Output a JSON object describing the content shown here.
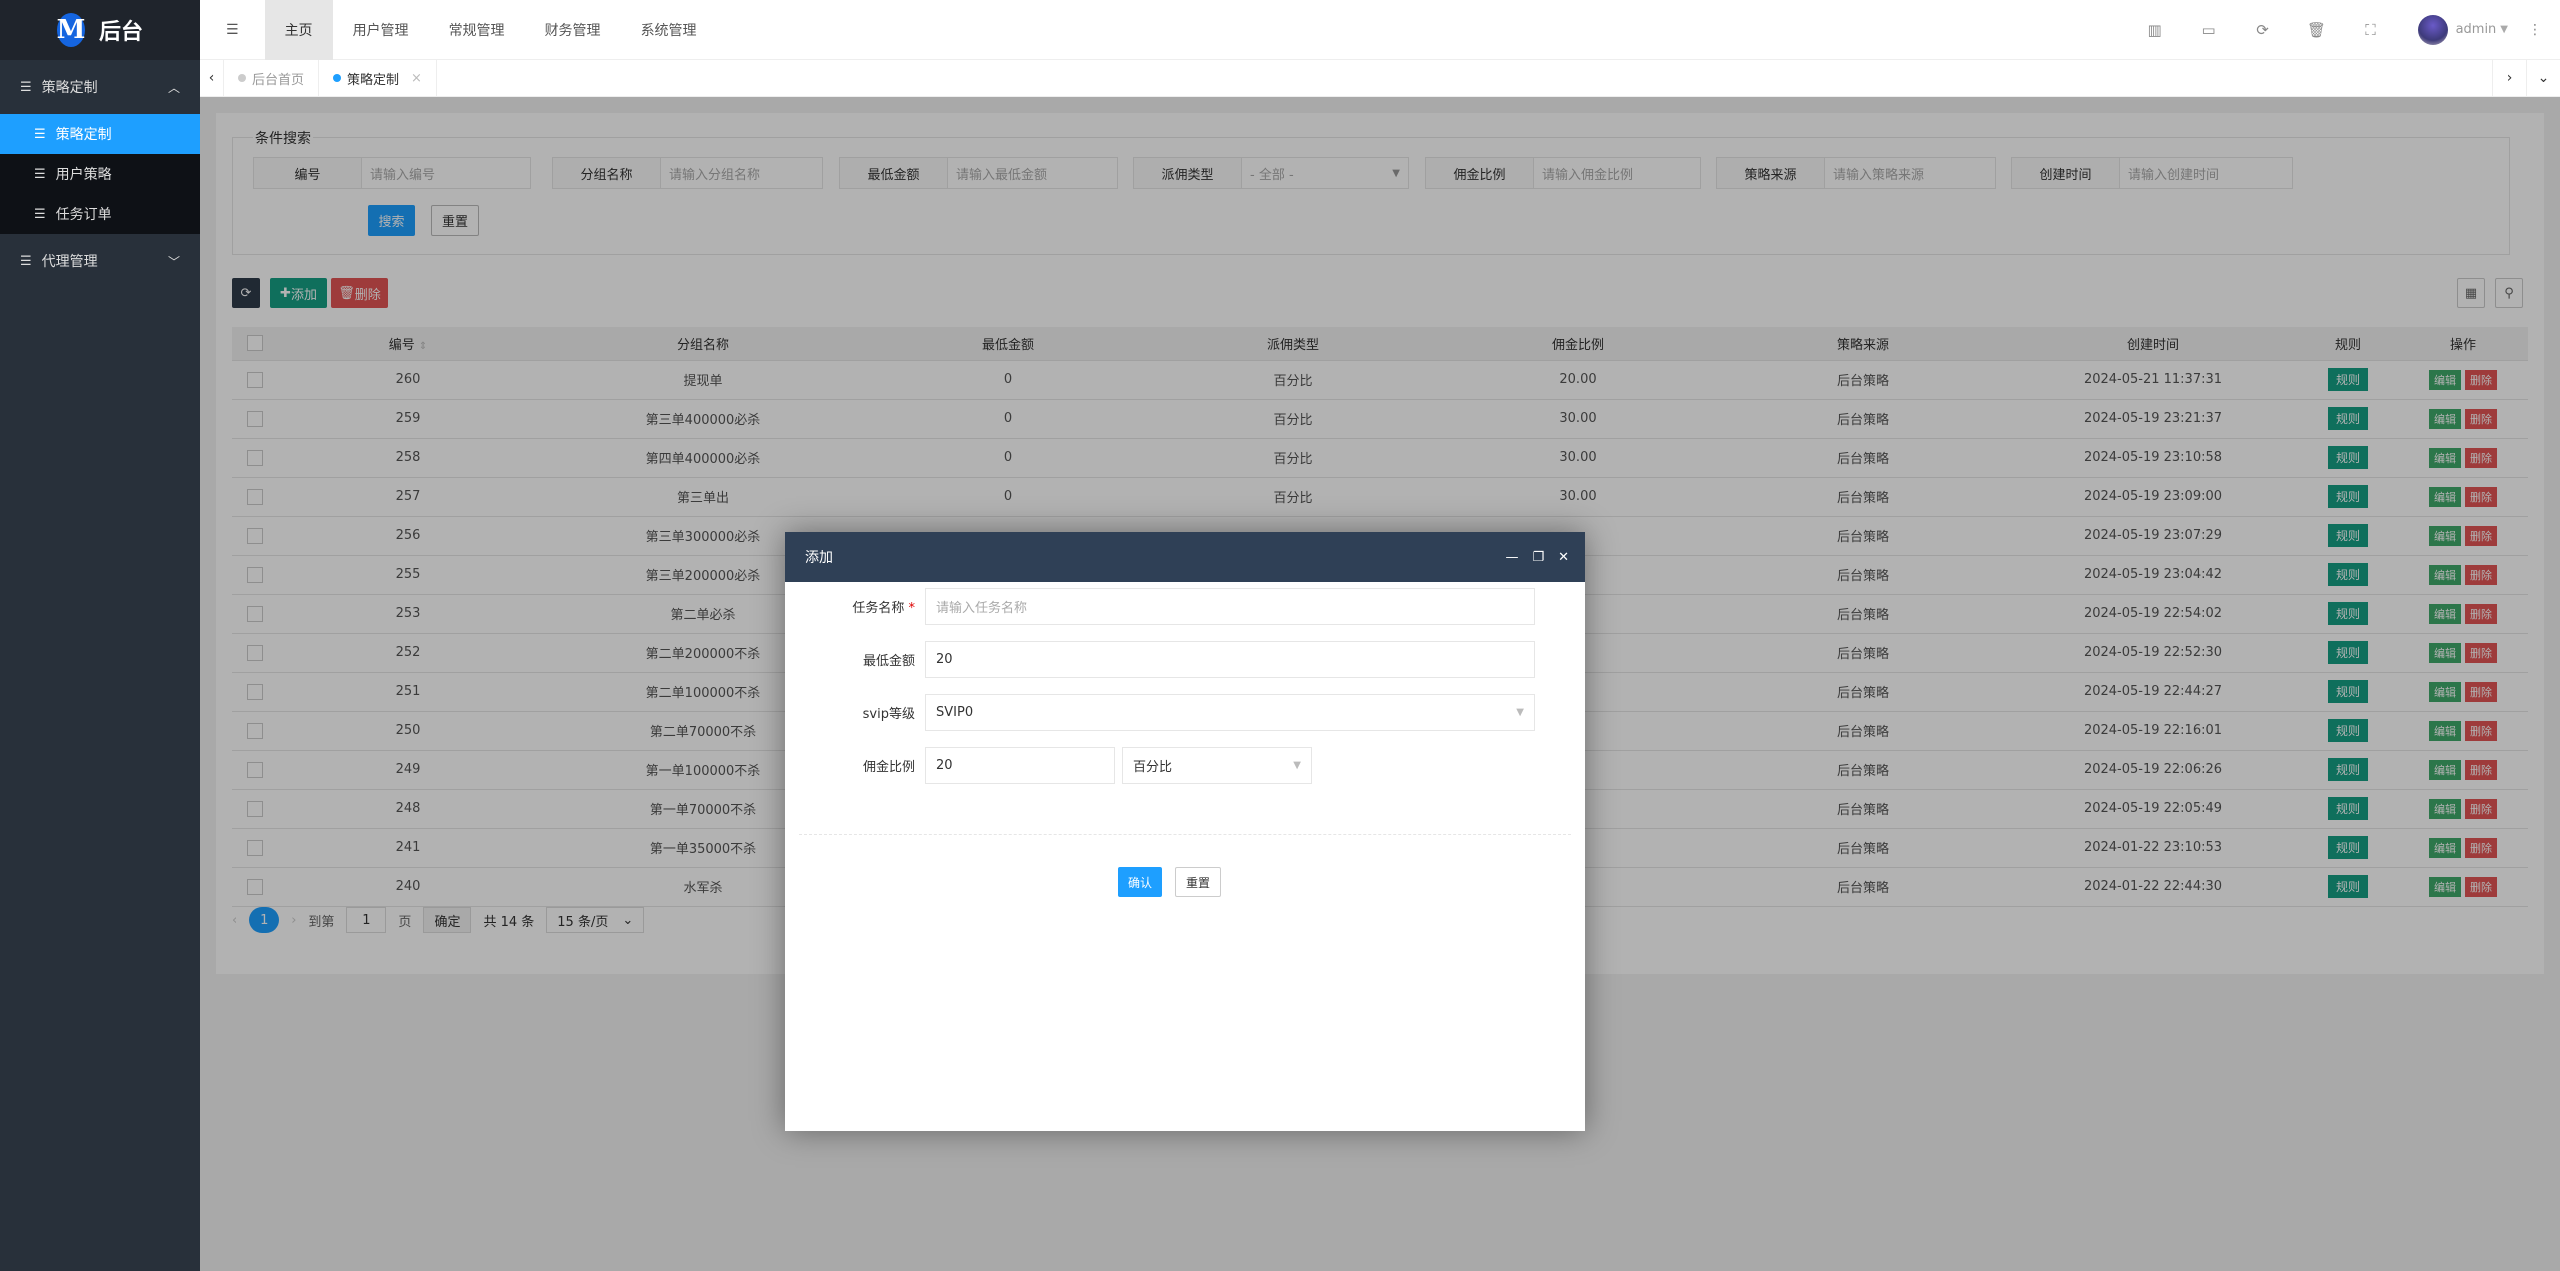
{
  "app": {
    "logo_letter": "M",
    "title": "后台"
  },
  "sidebar": {
    "groups": [
      {
        "label": "策略定制",
        "expanded": true,
        "items": [
          {
            "label": "策略定制",
            "active": true
          },
          {
            "label": "用户策略"
          },
          {
            "label": "任务订单"
          }
        ]
      },
      {
        "label": "代理管理",
        "expanded": false
      }
    ]
  },
  "topnav": {
    "items": [
      "主页",
      "用户管理",
      "常规管理",
      "财务管理",
      "系统管理"
    ],
    "active": "主页",
    "user": "admin"
  },
  "tabs": [
    {
      "label": "后台首页"
    },
    {
      "label": "策略定制",
      "active": true,
      "close": "×"
    }
  ],
  "search": {
    "legend": "条件搜索",
    "fields": [
      {
        "label": "编号",
        "placeholder": "请输入编号"
      },
      {
        "label": "分组名称",
        "placeholder": "请输入分组名称"
      },
      {
        "label": "最低金额",
        "placeholder": "请输入最低金额"
      },
      {
        "label": "派佣类型",
        "value": "- 全部 -"
      },
      {
        "label": "佣金比例",
        "placeholder": "请输入佣金比例"
      },
      {
        "label": "策略来源",
        "placeholder": "请输入策略来源"
      },
      {
        "label": "创建时间",
        "placeholder": "请输入创建时间"
      }
    ],
    "search_label": "搜索",
    "reset_label": "重置"
  },
  "toolbar": {
    "add_label": "添加",
    "delete_label": "删除"
  },
  "table": {
    "headers": [
      "编号",
      "分组名称",
      "最低金额",
      "派佣类型",
      "佣金比例",
      "策略来源",
      "创建时间",
      "规则",
      "操作"
    ],
    "rule_label": "规则",
    "edit_label": "编辑",
    "delete_label": "删除",
    "rows": [
      [
        "260",
        "提现单",
        "0",
        "百分比",
        "20.00",
        "后台策略",
        "2024-05-21 11:37:31"
      ],
      [
        "259",
        "第三单400000必杀",
        "0",
        "百分比",
        "30.00",
        "后台策略",
        "2024-05-19 23:21:37"
      ],
      [
        "258",
        "第四单400000必杀",
        "0",
        "百分比",
        "30.00",
        "后台策略",
        "2024-05-19 23:10:58"
      ],
      [
        "257",
        "第三单出",
        "0",
        "百分比",
        "30.00",
        "后台策略",
        "2024-05-19 23:09:00"
      ],
      [
        "256",
        "第三单300000必杀",
        "",
        "",
        "",
        "后台策略",
        "2024-05-19 23:07:29"
      ],
      [
        "255",
        "第三单200000必杀",
        "",
        "",
        "",
        "后台策略",
        "2024-05-19 23:04:42"
      ],
      [
        "253",
        "第二单必杀",
        "",
        "",
        "",
        "后台策略",
        "2024-05-19 22:54:02"
      ],
      [
        "252",
        "第二单200000不杀",
        "",
        "",
        "",
        "后台策略",
        "2024-05-19 22:52:30"
      ],
      [
        "251",
        "第二单100000不杀",
        "",
        "",
        "",
        "后台策略",
        "2024-05-19 22:44:27"
      ],
      [
        "250",
        "第二单70000不杀",
        "",
        "",
        "",
        "后台策略",
        "2024-05-19 22:16:01"
      ],
      [
        "249",
        "第一单100000不杀",
        "",
        "",
        "",
        "后台策略",
        "2024-05-19 22:06:26"
      ],
      [
        "248",
        "第一单70000不杀",
        "",
        "",
        "",
        "后台策略",
        "2024-05-19 22:05:49"
      ],
      [
        "241",
        "第一单35000不杀",
        "",
        "",
        "",
        "后台策略",
        "2024-01-22 23:10:53"
      ],
      [
        "240",
        "水军杀",
        "",
        "",
        "",
        "后台策略",
        "2024-01-22 22:44:30"
      ]
    ]
  },
  "pagination": {
    "current": "1",
    "goto_label": "到第",
    "page_value": "1",
    "page_label": "页",
    "confirm_label": "确定",
    "total": "共 14 条",
    "page_size": "15 条/页"
  },
  "modal": {
    "title": "添加",
    "fields": [
      {
        "label": "任务名称",
        "required": "*",
        "placeholder": "请输入任务名称"
      },
      {
        "label": "最低金额",
        "value": "20"
      },
      {
        "label": "svip等级",
        "value": "SVIP0"
      },
      {
        "label": "佣金比例",
        "value": "20",
        "unit": "百分比"
      }
    ],
    "confirm_label": "确认",
    "reset_label": "重置"
  },
  "colors": {
    "accent": "#1e9fff",
    "sidebar": "#28303a",
    "modal_header": "#2f4056",
    "rule": "#16a085",
    "edit": "#3fa96b",
    "delete": "#e25555"
  }
}
